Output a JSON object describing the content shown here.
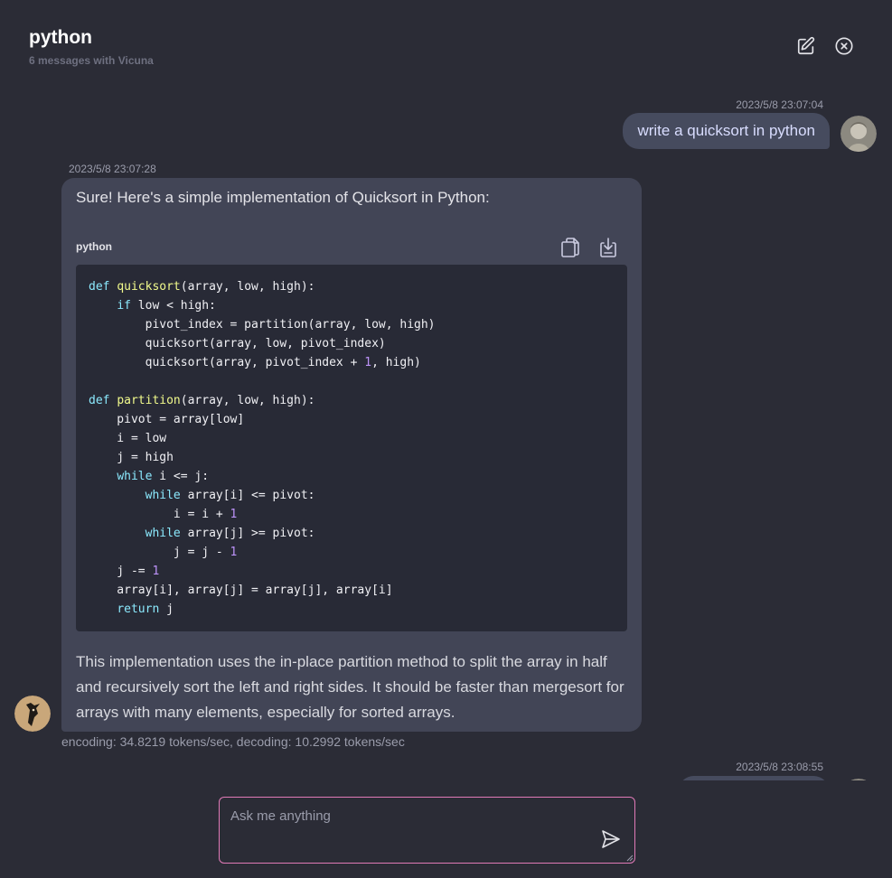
{
  "header": {
    "title": "python",
    "subtitle": "6 messages with Vicuna"
  },
  "messages": [
    {
      "role": "user",
      "timestamp": "2023/5/8 23:07:04",
      "text": "write a quicksort in python"
    },
    {
      "role": "assistant",
      "timestamp": "2023/5/8 23:07:28",
      "intro": "Sure! Here's a simple implementation of Quicksort in Python:",
      "code_language": "python",
      "code_lines": [
        "def quicksort(array, low, high):",
        "    if low < high:",
        "        pivot_index = partition(array, low, high)",
        "        quicksort(array, low, pivot_index)",
        "        quicksort(array, pivot_index + 1, high)",
        "",
        "def partition(array, low, high):",
        "    pivot = array[low]",
        "    i = low",
        "    j = high",
        "    while i <= j:",
        "        while array[i] <= pivot:",
        "            i = i + 1",
        "        while array[j] >= pivot:",
        "            j = j - 1",
        "    j -= 1",
        "    array[i], array[j] = array[j], array[i]",
        "    return j"
      ],
      "outro": "This implementation uses the in-place partition method to split the array in half and recursively sort the left and right sides. It should be faster than mergesort for arrays with many elements, especially for sorted arrays.",
      "stats": "encoding: 34.8219 tokens/sec, decoding: 10.2992 tokens/sec"
    },
    {
      "role": "user",
      "timestamp": "2023/5/8 23:08:55",
      "text": ""
    }
  ],
  "composer": {
    "placeholder": "Ask me anything"
  },
  "icons": {
    "edit": "edit-icon",
    "close": "close-circle-icon",
    "copy": "copy-icon",
    "download": "download-icon",
    "send": "send-icon"
  },
  "colors": {
    "background": "#2b2c36",
    "bot_bubble": "#424556",
    "user_bubble": "#464b5e",
    "code_bg": "#282a36",
    "input_border": "#e07ab7"
  }
}
